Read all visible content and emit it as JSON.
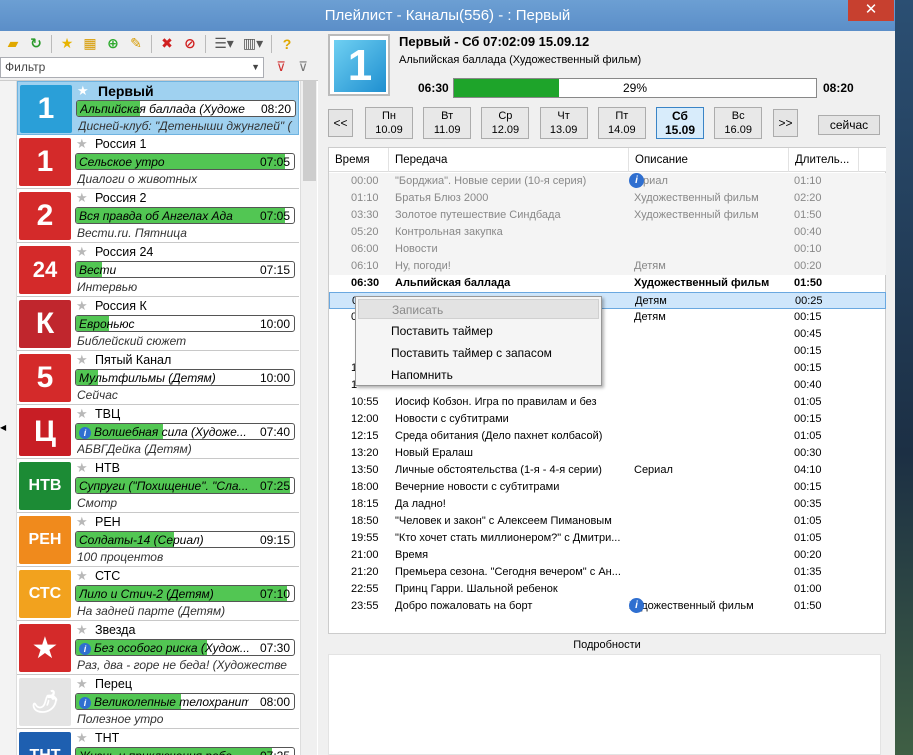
{
  "window": {
    "title": "Плейлист - Каналы(556) -  : Первый",
    "close": "✕"
  },
  "filter": {
    "value": "Фильтр"
  },
  "channels": [
    {
      "name": "Первый",
      "prog": "Альпийская баллада (Художе",
      "time": "08:20",
      "next": "Дисней-клуб: \"Детеныши джунглей\" (",
      "fill": 29,
      "logo": "1",
      "color": "#2a9fd8",
      "sel": true
    },
    {
      "name": "Россия 1",
      "prog": "Сельское утро",
      "time": "07:05",
      "next": "Диалоги о животных",
      "fill": 96,
      "logo": "1",
      "color": "#d42a2a"
    },
    {
      "name": "Россия 2",
      "prog": "Вся правда об Ангелах Ада",
      "time": "07:05",
      "next": "Вести.ru. Пятница",
      "fill": 96,
      "logo": "2",
      "color": "#d42a2a"
    },
    {
      "name": "Россия 24",
      "prog": "Вести",
      "time": "07:15",
      "next": "Интервью",
      "fill": 12,
      "logo": "24",
      "color": "#d42a2a"
    },
    {
      "name": "Россия К",
      "prog": "Евроньюс",
      "time": "10:00",
      "next": "Библейский сюжет",
      "fill": 15,
      "logo": "К",
      "color": "#c0262d"
    },
    {
      "name": "Пятый Канал",
      "prog": "Мультфильмы (Детям)",
      "time": "10:00",
      "next": "Сейчас",
      "fill": 10,
      "logo": "5",
      "color": "#d42a2a"
    },
    {
      "name": "ТВЦ",
      "prog": "Волшебная сила (Художе...",
      "time": "07:40",
      "next": "АБВГДейка (Детям)",
      "fill": 40,
      "logo": "Ц",
      "color": "#c81e25",
      "info": true
    },
    {
      "name": "НТВ",
      "prog": "Супруги (\"Похищение\". \"Сла...",
      "time": "07:25",
      "next": "Смотр",
      "fill": 98,
      "logo": "НТВ",
      "color": "#1c8b35"
    },
    {
      "name": "РЕН",
      "prog": "Солдаты-14 (Сериал)",
      "time": "09:15",
      "next": "100 процентов",
      "fill": 45,
      "logo": "РЕН",
      "color": "#f08a1c"
    },
    {
      "name": "СТС",
      "prog": "Лило и Стич-2 (Детям)",
      "time": "07:10",
      "next": "На задней парте (Детям)",
      "fill": 97,
      "logo": "СТС",
      "color": "#f2a21e"
    },
    {
      "name": "Звезда",
      "prog": "Без особого риска (Худож...",
      "time": "07:30",
      "next": "Раз, два - горе не беда! (Художестве",
      "fill": 60,
      "logo": "★",
      "color": "#d42a2a",
      "info": true
    },
    {
      "name": "Перец",
      "prog": "Великолепные телохранит...",
      "time": "08:00",
      "next": "Полезное утро",
      "fill": 48,
      "logo": "🌶",
      "color": "#e4e4e4",
      "info": true
    },
    {
      "name": "ТНТ",
      "prog": "Жизнь и приключения ребе...",
      "time": "07:25",
      "next": "",
      "fill": 90,
      "logo": "ТНТ",
      "color": "#1e5fb0"
    }
  ],
  "now": {
    "title": "Первый - Сб 07:02:09  15.09.12",
    "subtitle": "Альпийская баллада (Художественный фильм)",
    "start": "06:30",
    "end": "08:20",
    "percent": "29%",
    "fill": 29
  },
  "days": [
    {
      "d": "Пн",
      "dt": "10.09"
    },
    {
      "d": "Вт",
      "dt": "11.09"
    },
    {
      "d": "Ср",
      "dt": "12.09"
    },
    {
      "d": "Чт",
      "dt": "13.09"
    },
    {
      "d": "Пт",
      "dt": "14.09"
    },
    {
      "d": "Сб",
      "dt": "15.09",
      "active": true
    },
    {
      "d": "Вс",
      "dt": "16.09"
    }
  ],
  "nav": {
    "prev": "<<",
    "next": ">>",
    "now": "сейчас"
  },
  "columns": [
    "Время",
    "Передача",
    "Описание",
    "Длитель..."
  ],
  "rows": [
    {
      "t": "00:00",
      "p": "\"Борджиа\". Новые серии (10-я серия)",
      "d": "Сериал",
      "l": "01:10",
      "past": true,
      "info": true
    },
    {
      "t": "01:10",
      "p": "Братья Блюз 2000",
      "d": "Художественный фильм",
      "l": "02:20",
      "past": true
    },
    {
      "t": "03:30",
      "p": "Золотое путешествие Синдбада",
      "d": "Художественный фильм",
      "l": "01:50",
      "past": true
    },
    {
      "t": "05:20",
      "p": "Контрольная закупка",
      "d": "",
      "l": "00:40",
      "past": true
    },
    {
      "t": "06:00",
      "p": "Новости",
      "d": "",
      "l": "00:10",
      "past": true
    },
    {
      "t": "06:10",
      "p": "Ну, погоди!",
      "d": "Детям",
      "l": "00:20",
      "past": true
    },
    {
      "t": "06:30",
      "p": "Альпийская баллада",
      "d": "Художественный фильм",
      "l": "01:50",
      "cur": true
    },
    {
      "t": "0",
      "p": "",
      "d": "Детям",
      "l": "00:25",
      "hl": true
    },
    {
      "t": "0",
      "p": "",
      "d": "Детям",
      "l": "00:15"
    },
    {
      "t": "",
      "p": "",
      "d": "",
      "l": "00:45"
    },
    {
      "t": "",
      "p": "",
      "d": "",
      "l": "00:15"
    },
    {
      "t": "1",
      "p": "",
      "d": "",
      "l": "00:15"
    },
    {
      "t": "1",
      "p": "",
      "d": "",
      "l": "00:40"
    },
    {
      "t": "10:55",
      "p": "Иосиф Кобзон. Игра по правилам и без",
      "d": "",
      "l": "01:05"
    },
    {
      "t": "12:00",
      "p": "Новости с субтитрами",
      "d": "",
      "l": "00:15"
    },
    {
      "t": "12:15",
      "p": "Среда обитания (Дело пахнет колбасой)",
      "d": "",
      "l": "01:05"
    },
    {
      "t": "13:20",
      "p": "Новый Ералаш",
      "d": "",
      "l": "00:30"
    },
    {
      "t": "13:50",
      "p": "Личные обстоятельства (1-я - 4-я серии)",
      "d": "Сериал",
      "l": "04:10"
    },
    {
      "t": "18:00",
      "p": "Вечерние новости с субтитрами",
      "d": "",
      "l": "00:15"
    },
    {
      "t": "18:15",
      "p": "Да ладно!",
      "d": "",
      "l": "00:35"
    },
    {
      "t": "18:50",
      "p": "\"Человек и закон\" с Алексеем Пимановым",
      "d": "",
      "l": "01:05"
    },
    {
      "t": "19:55",
      "p": "\"Кто хочет стать миллионером?\" с Дмитри...",
      "d": "",
      "l": "01:05"
    },
    {
      "t": "21:00",
      "p": "Время",
      "d": "",
      "l": "00:20"
    },
    {
      "t": "21:20",
      "p": "Премьера сезона. \"Сегодня вечером\" с Ан...",
      "d": "",
      "l": "01:35"
    },
    {
      "t": "22:55",
      "p": "Принц Гарри. Шальной ребенок",
      "d": "",
      "l": "01:00"
    },
    {
      "t": "23:55",
      "p": "Добро пожаловать на борт",
      "d": "Художественный фильм",
      "l": "01:50",
      "info": true
    }
  ],
  "menu": [
    "Записать",
    "Поставить таймер",
    "Поставить таймер с запасом",
    "Напомнить"
  ],
  "details": "Подробности"
}
